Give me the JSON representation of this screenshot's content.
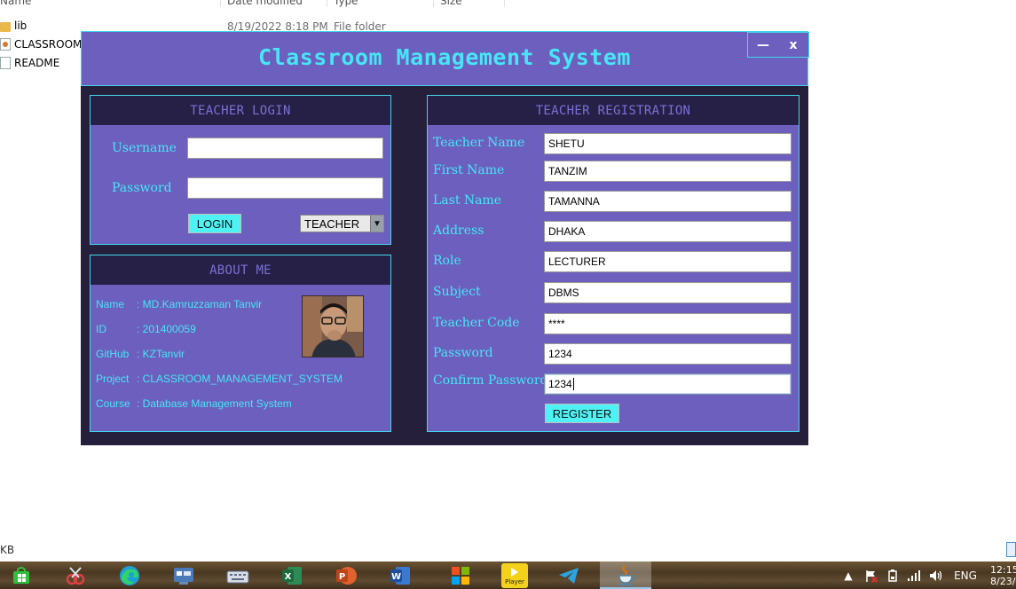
{
  "explorer": {
    "headers": [
      "Name",
      "Date modified",
      "Type",
      "Size"
    ],
    "files": [
      {
        "name": "lib",
        "date": "8/19/2022 8:18 PM",
        "type": "File folder",
        "icon": "folder-icon"
      },
      {
        "name": "CLASSROOM_",
        "date": "",
        "type": "",
        "icon": "jar-file-icon"
      },
      {
        "name": "README",
        "date": "",
        "type": "",
        "icon": "text-file-icon"
      }
    ],
    "status_text": "KB"
  },
  "app": {
    "title": "Classroom Management System",
    "minimize_label": "—",
    "close_label": "x"
  },
  "login": {
    "heading": "TEACHER LOGIN",
    "username_label": "Username",
    "password_label": "Password",
    "username_value": "",
    "password_value": "",
    "login_button": "LOGIN",
    "role_selected": "TEACHER"
  },
  "about": {
    "heading": "ABOUT ME",
    "lines": [
      {
        "key": "Name",
        "sep": ": ",
        "value": "MD.Kamruzzaman Tanvir"
      },
      {
        "key": "ID",
        "sep": ": ",
        "value": "201400059"
      },
      {
        "key": "GitHub",
        "sep": ": ",
        "value": "KZTanvir"
      },
      {
        "key": "Project",
        "sep": ": ",
        "value": "CLASSROOM_MANAGEMENT_SYSTEM"
      },
      {
        "key": "Course",
        "sep": ": ",
        "value": "Database Management System"
      }
    ]
  },
  "registration": {
    "heading": "TEACHER REGISTRATION",
    "fields": [
      {
        "label": "Teacher Name",
        "value": "SHETU"
      },
      {
        "label": "First Name",
        "value": "TANZIM"
      },
      {
        "label": "Last Name",
        "value": "TAMANNA"
      },
      {
        "label": "Address",
        "value": "DHAKA"
      },
      {
        "label": "Role",
        "value": "LECTURER"
      },
      {
        "label": "Subject",
        "value": "DBMS"
      },
      {
        "label": "Teacher Code",
        "value": "****"
      },
      {
        "label": "Password",
        "value": "1234"
      },
      {
        "label": "Confirm Password",
        "value": "1234"
      }
    ],
    "register_button": "REGISTER"
  },
  "taskbar": {
    "apps": [
      "start-icon",
      "snipping-tool-icon",
      "edge-icon",
      "control-panel-icon",
      "on-screen-keyboard-icon",
      "excel-icon",
      "powerpoint-icon",
      "word-icon",
      "office-icon",
      "player-icon",
      "telegram-icon",
      "java-icon"
    ],
    "player_label": "Player",
    "language": "ENG",
    "time": "12:15",
    "date": "8/23/"
  },
  "colors": {
    "panel": "#6c5fbe",
    "accent": "#47e6f5",
    "frame": "#261f3c",
    "button": "#4ff2f4"
  }
}
